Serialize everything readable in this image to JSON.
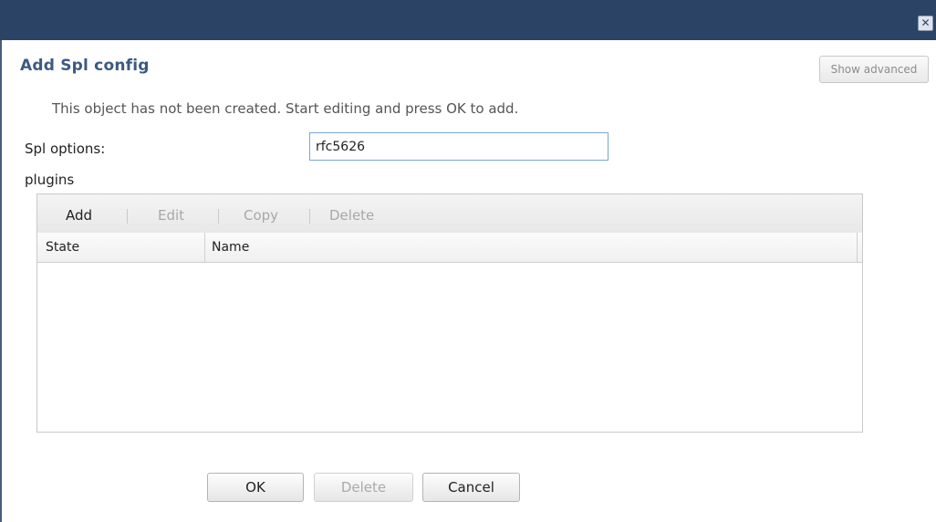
{
  "window": {
    "close_icon": "close-icon",
    "close_glyph": "✕"
  },
  "dialog": {
    "title": "Add Spl config",
    "show_advanced_label": "Show advanced",
    "info_message": "This object has not been created. Start editing and press OK to add."
  },
  "form": {
    "spl_options_label": "Spl options:",
    "spl_options_value": "rfc5626"
  },
  "plugins": {
    "section_label": "plugins",
    "toolbar": {
      "add": "Add",
      "edit": "Edit",
      "copy": "Copy",
      "delete": "Delete"
    },
    "columns": [
      "State",
      "Name"
    ],
    "rows": []
  },
  "footer": {
    "ok_label": "OK",
    "delete_label": "Delete",
    "cancel_label": "Cancel"
  },
  "colors": {
    "titlebar": "#2b4466",
    "title_text": "#3d5a80",
    "disabled_text": "#a8a8a8",
    "input_border": "#7aa7d6"
  }
}
